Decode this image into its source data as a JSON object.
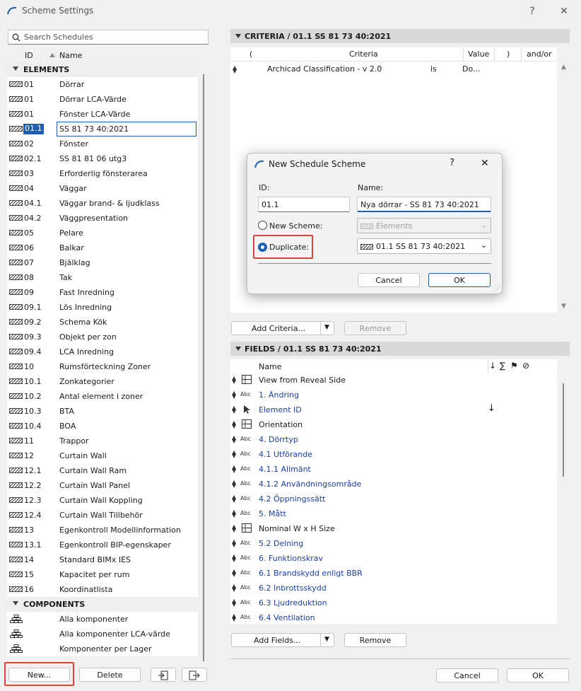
{
  "window": {
    "title": "Scheme Settings",
    "help": "?",
    "close": "✕"
  },
  "search": {
    "placeholder": "Search Schedules"
  },
  "list_header": {
    "id": "ID",
    "name": "Name"
  },
  "groups": {
    "elements": "ELEMENTS",
    "components": "COMPONENTS"
  },
  "elements": [
    {
      "id": "01",
      "name": "Dörrar"
    },
    {
      "id": "01",
      "name": "Dörrar LCA-Värde"
    },
    {
      "id": "01",
      "name": "Fönster LCA-Värde"
    },
    {
      "id": "01.1",
      "name": "SS 81 73 40:2021",
      "selected": true
    },
    {
      "id": "02",
      "name": "Fönster"
    },
    {
      "id": "02.1",
      "name": "SS 81 81 06 utg3"
    },
    {
      "id": "03",
      "name": "Erforderlig fönsterarea"
    },
    {
      "id": "04",
      "name": "Väggar"
    },
    {
      "id": "04.1",
      "name": "Väggar brand- & ljudklass"
    },
    {
      "id": "04.2",
      "name": "Väggpresentation"
    },
    {
      "id": "05",
      "name": "Pelare"
    },
    {
      "id": "06",
      "name": "Balkar"
    },
    {
      "id": "07",
      "name": "Bjälklag"
    },
    {
      "id": "08",
      "name": "Tak"
    },
    {
      "id": "09",
      "name": "Fast Inredning"
    },
    {
      "id": "09.1",
      "name": "Lös Inredning"
    },
    {
      "id": "09.2",
      "name": "Schema Kök"
    },
    {
      "id": "09.3",
      "name": "Objekt per zon"
    },
    {
      "id": "09.4",
      "name": "LCA Inredning"
    },
    {
      "id": "10",
      "name": "Rumsförteckning Zoner"
    },
    {
      "id": "10.1",
      "name": "Zonkategorier"
    },
    {
      "id": "10.2",
      "name": "Antal element i zoner"
    },
    {
      "id": "10.3",
      "name": "BTA"
    },
    {
      "id": "10.4",
      "name": "BOA"
    },
    {
      "id": "11",
      "name": "Trappor"
    },
    {
      "id": "12",
      "name": "Curtain Wall"
    },
    {
      "id": "12.1",
      "name": "Curtain Wall Ram"
    },
    {
      "id": "12.2",
      "name": "Curtain Wall Panel"
    },
    {
      "id": "12.3",
      "name": "Curtain Wall Koppling"
    },
    {
      "id": "12.4",
      "name": "Curtain Wall Tillbehör"
    },
    {
      "id": "13",
      "name": "Egenkontroll Modellinformation"
    },
    {
      "id": "13.1",
      "name": "Egenkontroll BIP-egenskaper"
    },
    {
      "id": "14",
      "name": "Standard BIMx IES"
    },
    {
      "id": "15",
      "name": "Kapacitet per rum"
    },
    {
      "id": "16",
      "name": "Koordinatlista"
    }
  ],
  "components": [
    {
      "name": "Alla komponenter"
    },
    {
      "name": "Alla komponenter LCA-värde"
    },
    {
      "name": "Komponenter per Lager"
    }
  ],
  "left_buttons": {
    "new": "New...",
    "delete": "Delete"
  },
  "criteria": {
    "header": "CRITERIA / 01.1 SS 81 73 40:2021",
    "columns": {
      "open": "(",
      "criteria": "Criteria",
      "value": "Value",
      "close": ")",
      "andor": "and/or"
    },
    "row": {
      "criteria": "Archicad Classification - v 2.0",
      "op": "is",
      "value": "Do..."
    },
    "add_label": "Add Criteria...",
    "remove_label": "Remove"
  },
  "fields": {
    "header": "FIELDS / 01.1 SS 81 73 40:2021",
    "name_col": "Name",
    "icons": {
      "sort": "↓",
      "sum": "∑",
      "flag": "⚑",
      "hide": "⊘"
    },
    "rows": [
      {
        "name": "View from Reveal Side",
        "icon": "grid",
        "blue": false
      },
      {
        "name": "1. Ändring",
        "icon": "Abc",
        "blue": true
      },
      {
        "name": "Element ID",
        "icon": "cursor",
        "blue": true,
        "sort": "↓"
      },
      {
        "name": "Orientation",
        "icon": "grid",
        "blue": false
      },
      {
        "name": "4. Dörrtyp",
        "icon": "Abc",
        "blue": true
      },
      {
        "name": "4.1 Utförande",
        "icon": "Abc",
        "blue": true
      },
      {
        "name": "4.1.1 Allmänt",
        "icon": "Abc",
        "blue": true
      },
      {
        "name": "4.1.2 Användningsområde",
        "icon": "Abc",
        "blue": true
      },
      {
        "name": "4.2 Öppningssätt",
        "icon": "Abc",
        "blue": true
      },
      {
        "name": "5. Mått",
        "icon": "Abc",
        "blue": true
      },
      {
        "name": "Nominal W x H Size",
        "icon": "grid",
        "blue": false
      },
      {
        "name": "5.2 Delning",
        "icon": "Abc",
        "blue": true
      },
      {
        "name": "6. Funktionskrav",
        "icon": "Abc",
        "blue": true
      },
      {
        "name": "6.1 Brandskydd enligt BBR",
        "icon": "Abc",
        "blue": true
      },
      {
        "name": "6.2 Inbrottsskydd",
        "icon": "Abc",
        "blue": true
      },
      {
        "name": "6.3 Ljudreduktion",
        "icon": "Abc",
        "blue": true
      },
      {
        "name": "6.4 Ventilation",
        "icon": "Abc",
        "blue": true
      }
    ],
    "add_label": "Add Fields...",
    "remove_label": "Remove"
  },
  "footer": {
    "cancel": "Cancel",
    "ok": "OK"
  },
  "dialog": {
    "title": "New Schedule Scheme",
    "help": "?",
    "close": "✕",
    "id_label": "ID:",
    "id_value": "01.1",
    "name_label": "Name:",
    "name_value": "Nya dörrar - SS 81 73 40:2021",
    "new_scheme": "New Scheme:",
    "new_scheme_value": "Elements",
    "duplicate": "Duplicate:",
    "duplicate_value": "01.1 SS 81 73 40:2021",
    "cancel": "Cancel",
    "ok": "OK"
  }
}
